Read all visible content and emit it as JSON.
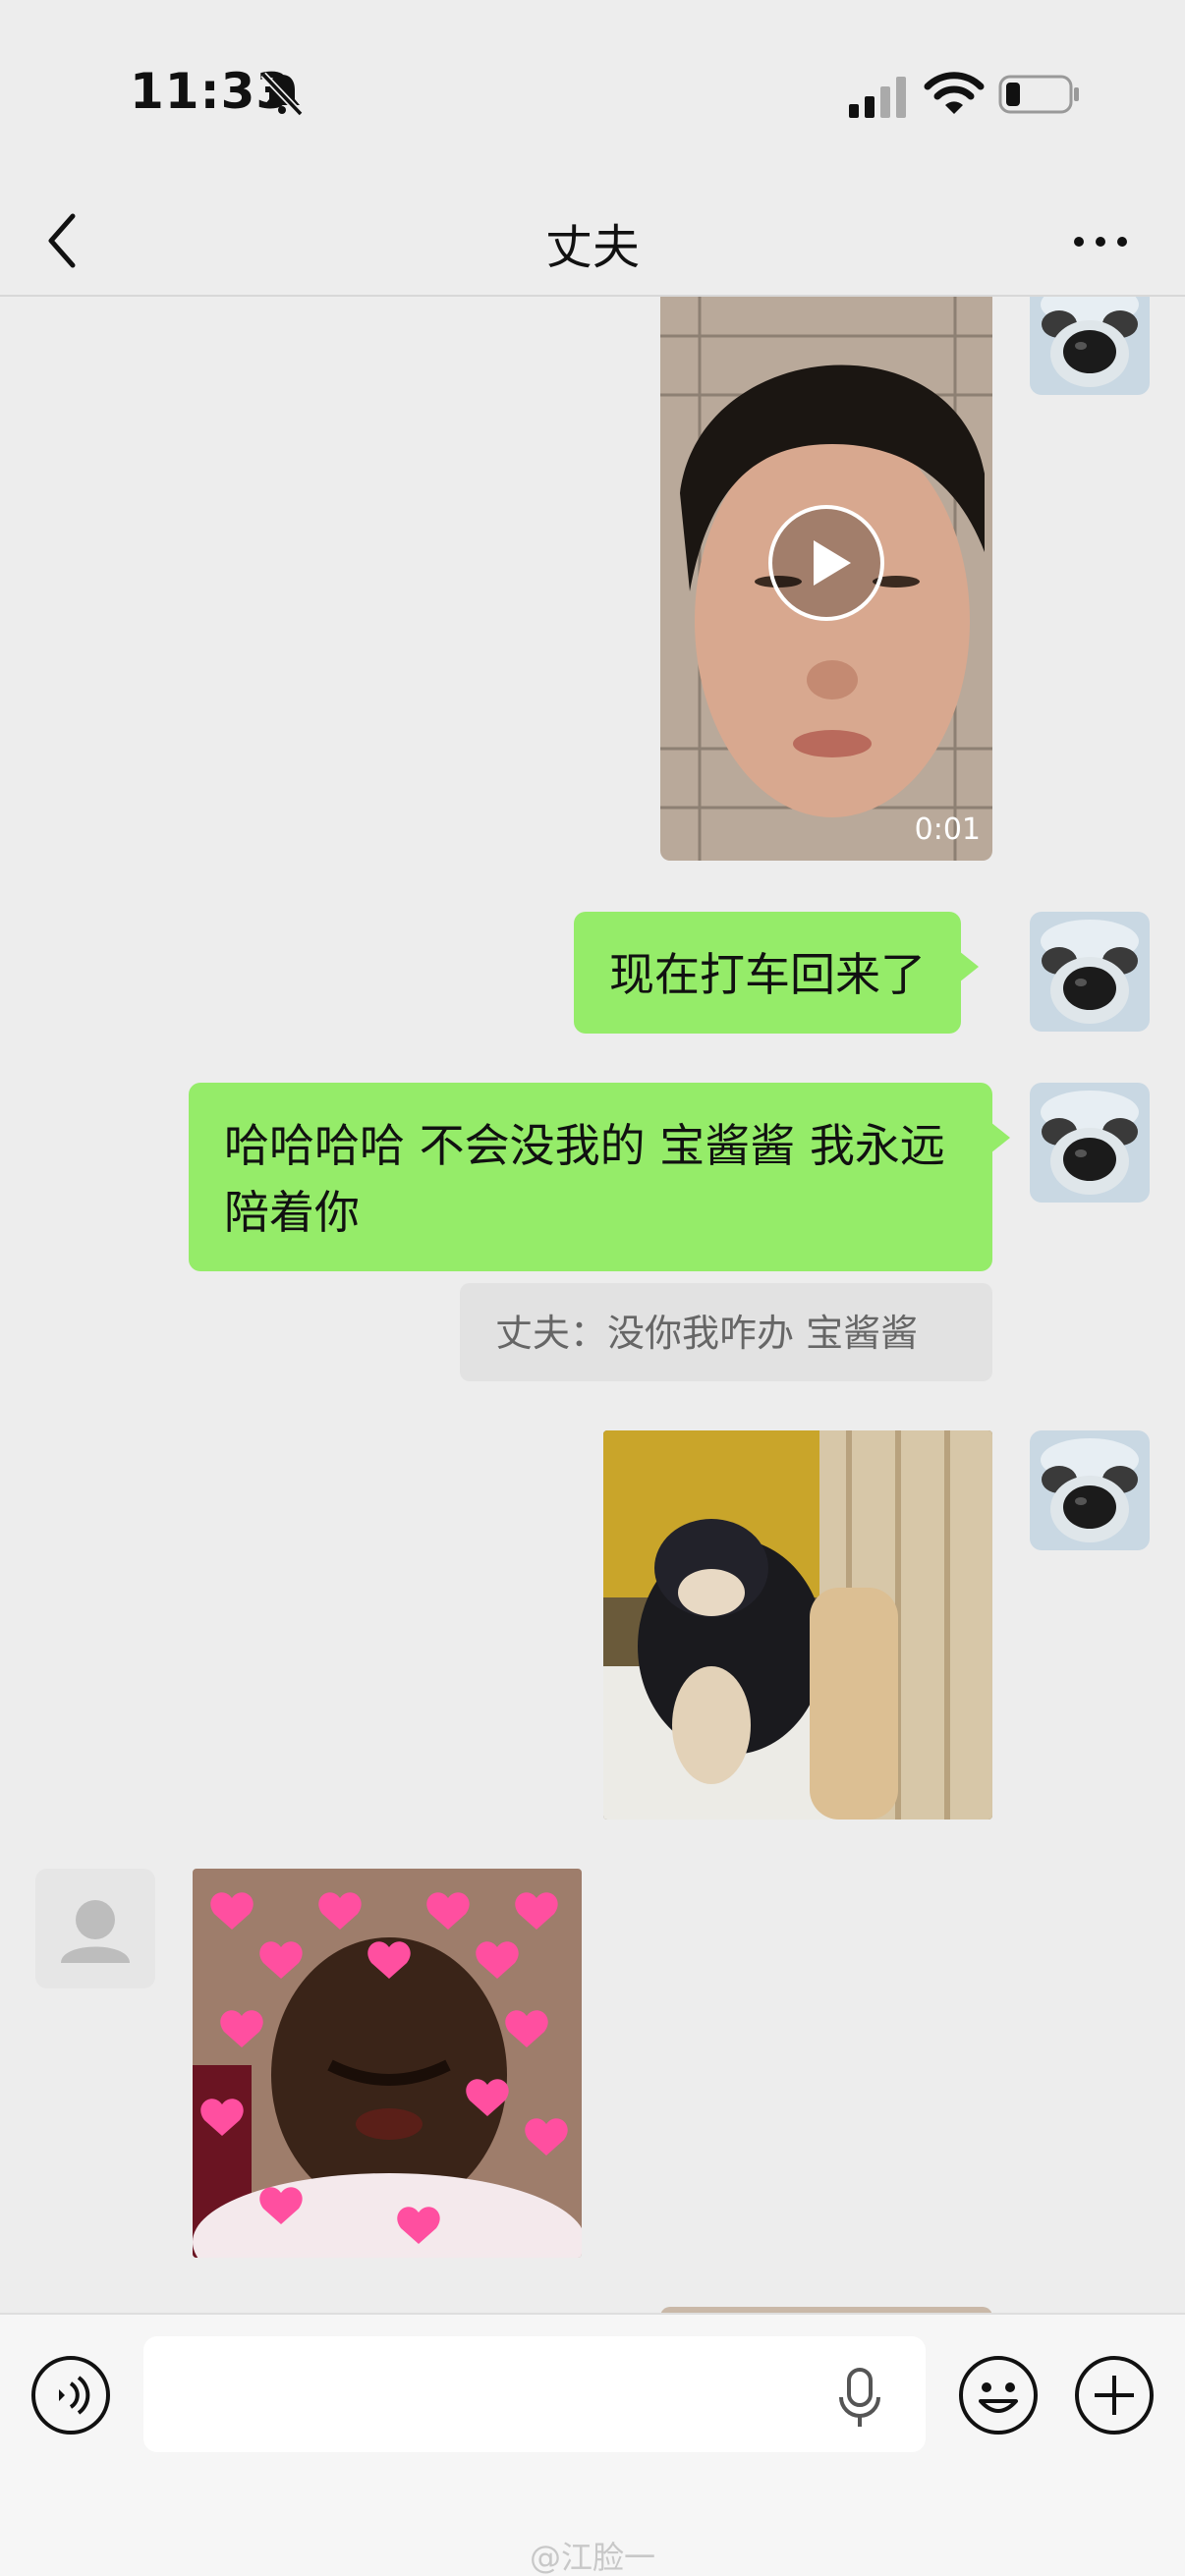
{
  "status_bar": {
    "time": "11:33",
    "bell_icon": "bell-slash-icon",
    "signal_icon": "cellular-signal-icon",
    "wifi_icon": "wifi-icon",
    "battery_icon": "battery-low-icon"
  },
  "nav": {
    "title": "丈夫",
    "back_icon": "chevron-left-icon",
    "more_icon": "more-dots-icon"
  },
  "messages": {
    "video": {
      "duration": "0:01",
      "play_icon": "play-icon"
    },
    "text1": "现在打车回来了",
    "text2": "哈哈哈哈 不会没我的 宝酱酱 我永远陪着你",
    "quote": "丈夫：没你我咋办 宝酱酱"
  },
  "input": {
    "placeholder": "",
    "voice_icon": "voice-icon",
    "mic_icon": "microphone-icon",
    "emoji_icon": "emoji-icon",
    "plus_icon": "plus-icon"
  },
  "watermark": "@江脸一",
  "colors": {
    "background": "#ededed",
    "bubble_green": "#95ec69",
    "quote_bg": "#e2e2e2"
  }
}
